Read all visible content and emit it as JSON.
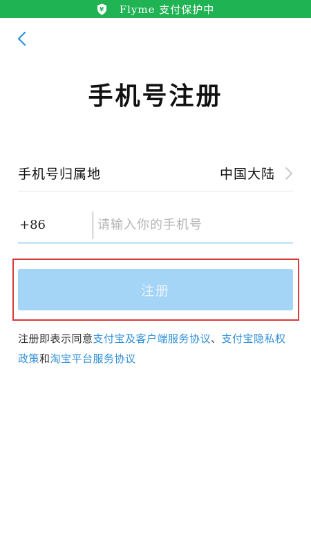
{
  "status_bar": {
    "text": "Flyme  支付保护中",
    "icon": "shield-yen-icon",
    "background": "#1fb353"
  },
  "nav": {
    "back_icon": "chevron-left-icon"
  },
  "title": "手机号注册",
  "region": {
    "label": "手机号归属地",
    "value": "中国大陆",
    "icon": "chevron-right-icon"
  },
  "phone": {
    "country_code": "+86",
    "placeholder": "请输入你的手机号",
    "value": ""
  },
  "register_button": {
    "label": "注册",
    "background": "#a4d4f6"
  },
  "highlight_color": "#d8393a",
  "agreement": {
    "prefix": "注册即表示同意",
    "link1": "支付宝及客户端服务协议",
    "sep": "、",
    "link2": "支付宝隐私权政策",
    "and": "和",
    "link3": "淘宝平台服务协议",
    "link_color": "#2f8fd6"
  }
}
